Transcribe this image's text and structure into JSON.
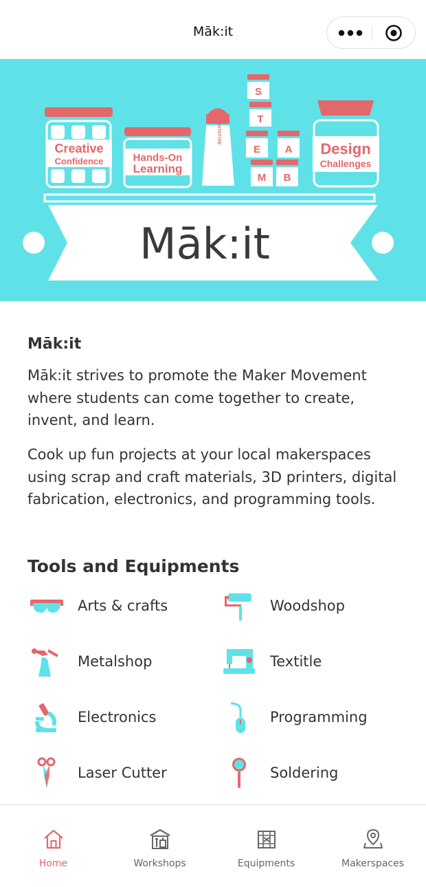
{
  "app": {
    "title": "Māk:it"
  },
  "capsule": {
    "menu_icon": "more-dots-icon",
    "close_icon": "target-close-icon"
  },
  "banner": {
    "jars": [
      "Creative",
      "Confidence",
      "Hands-On",
      "Learning",
      "PROTOTYPE",
      "Design",
      "Challenges"
    ],
    "steam": [
      "S",
      "T",
      "E",
      "A",
      "M",
      "B"
    ],
    "logo": "Māk:it",
    "colors": {
      "background": "#5fe1e8",
      "accent": "#e4676a"
    }
  },
  "intro": {
    "title": "Māk:it",
    "para1": "Māk:it strives to promote the Maker Movement where students can come together to create, invent, and learn.",
    "para2": "Cook up fun projects at your local makerspaces using scrap and craft materials, 3D printers, digital fabrication, electronics, and programming tools."
  },
  "tools": {
    "title": "Tools and Equipments",
    "items": [
      {
        "label": "Arts & crafts",
        "icon": "goggles-icon"
      },
      {
        "label": "Woodshop",
        "icon": "paint-roller-icon"
      },
      {
        "label": "Metalshop",
        "icon": "welding-torch-icon"
      },
      {
        "label": "Textitle",
        "icon": "sewing-machine-icon"
      },
      {
        "label": "Electronics",
        "icon": "microscope-icon"
      },
      {
        "label": "Programming",
        "icon": "mouse-icon"
      },
      {
        "label": "Laser Cutter",
        "icon": "scissors-icon"
      },
      {
        "label": "Soldering",
        "icon": "soldering-iron-icon"
      }
    ]
  },
  "tabbar": {
    "tabs": [
      {
        "label": "Home",
        "icon": "home-icon",
        "active": true
      },
      {
        "label": "Workshops",
        "icon": "workshop-icon",
        "active": false
      },
      {
        "label": "Equipments",
        "icon": "equipment-icon",
        "active": false
      },
      {
        "label": "Makerspaces",
        "icon": "map-pin-icon",
        "active": false
      }
    ],
    "colors": {
      "active": "#e4676a",
      "inactive": "#666666"
    }
  }
}
